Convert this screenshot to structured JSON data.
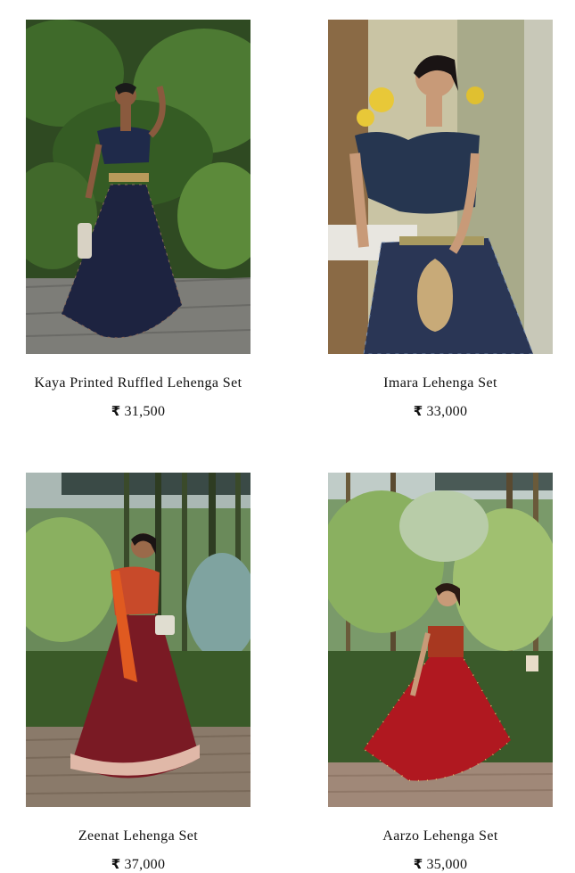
{
  "currency_symbol": "₹",
  "products": [
    {
      "name": "Kaya Printed Ruffled Lehenga Set",
      "price": "31,500",
      "image": "woman in navy ruffled one-shoulder blouse and printed lehenga in garden"
    },
    {
      "name": "Imara Lehenga Set",
      "price": "33,000",
      "image": "woman in navy ruffled blouse and printed lehenga holding gold potli bag"
    },
    {
      "name": "Zeenat Lehenga Set",
      "price": "37,000",
      "image": "woman in maroon and orange lehenga with dupatta among bamboo"
    },
    {
      "name": "Aarzo Lehenga Set",
      "price": "35,000",
      "image": "woman in red embroidered lehenga twirling on wooden deck"
    }
  ],
  "colors": {
    "background": "#ffffff",
    "text": "#111111"
  }
}
